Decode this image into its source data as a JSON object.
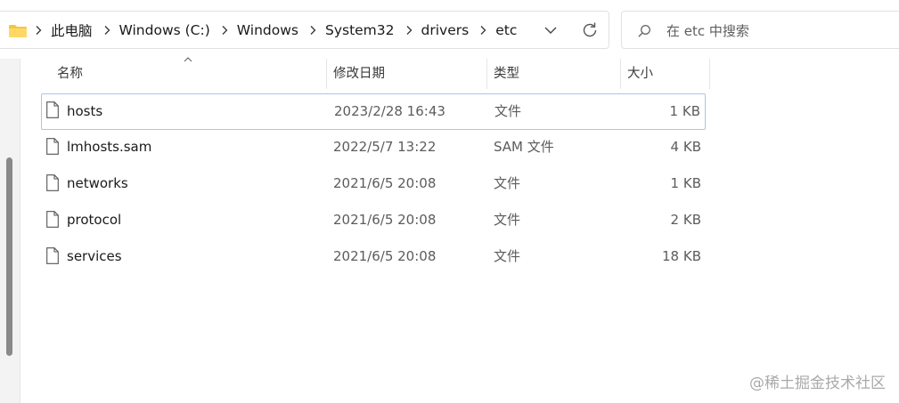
{
  "address_bar": {
    "breadcrumbs": [
      "此电脑",
      "Windows (C:)",
      "Windows",
      "System32",
      "drivers",
      "etc"
    ]
  },
  "search": {
    "placeholder": "在 etc 中搜索"
  },
  "columns": {
    "name": "名称",
    "date": "修改日期",
    "type": "类型",
    "size": "大小"
  },
  "files": [
    {
      "name": "hosts",
      "date": "2023/2/28 16:43",
      "type": "文件",
      "size": "1 KB",
      "selected": true
    },
    {
      "name": "lmhosts.sam",
      "date": "2022/5/7 13:22",
      "type": "SAM 文件",
      "size": "4 KB",
      "selected": false
    },
    {
      "name": "networks",
      "date": "2021/6/5 20:08",
      "type": "文件",
      "size": "1 KB",
      "selected": false
    },
    {
      "name": "protocol",
      "date": "2021/6/5 20:08",
      "type": "文件",
      "size": "2 KB",
      "selected": false
    },
    {
      "name": "services",
      "date": "2021/6/5 20:08",
      "type": "文件",
      "size": "18 KB",
      "selected": false
    }
  ],
  "watermark": "@稀土掘金技术社区",
  "colors": {
    "selection_border": "#a8c6e8",
    "folder": "#f5c542",
    "scrollbar": "#8a8a8a"
  },
  "icons": {
    "address_folder": "folder-icon",
    "breadcrumb_separator": "chevron-right-icon",
    "address_history": "chevron-down-icon",
    "refresh": "refresh-icon",
    "search": "search-icon",
    "file": "file-icon",
    "sort": "sort-up-icon"
  }
}
